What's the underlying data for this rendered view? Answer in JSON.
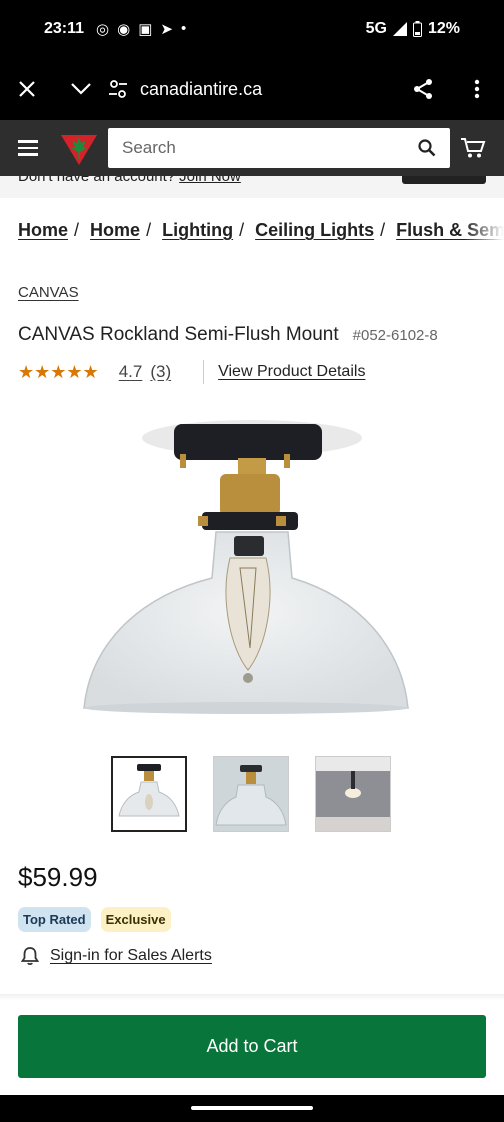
{
  "status": {
    "time": "23:11",
    "network": "5G",
    "battery": "12%"
  },
  "browser": {
    "url": "canadiantire.ca",
    "close_icon": "close-icon",
    "collapse_icon": "chevron-down-icon",
    "site_settings_icon": "tune-icon",
    "share_icon": "share-icon",
    "more_icon": "more-vert-icon"
  },
  "header": {
    "search_placeholder": "Search"
  },
  "account_strip": {
    "text": "Don't have an account?",
    "link": "Join Now"
  },
  "breadcrumb": [
    "Home",
    "Home",
    "Lighting",
    "Ceiling Lights",
    "Flush & Semi F"
  ],
  "product": {
    "brand": "CANVAS",
    "title": "CANVAS Rockland Semi-Flush Mount",
    "sku": "#052-6102-8",
    "stars": "★★★★★",
    "rating_value": 4.7,
    "rating": "4.7",
    "rating_count": "(3)",
    "details_link": "View Product Details",
    "price": "$59.99",
    "badges": [
      "Top Rated",
      "Exclusive"
    ],
    "alerts_link": "Sign-in for Sales Alerts",
    "add_to_cart": "Add to Cart"
  },
  "colors": {
    "header_bg": "#2e2e2e",
    "accent_red": "#d2232a",
    "cart_green": "#08753a",
    "star": "#d97706"
  }
}
